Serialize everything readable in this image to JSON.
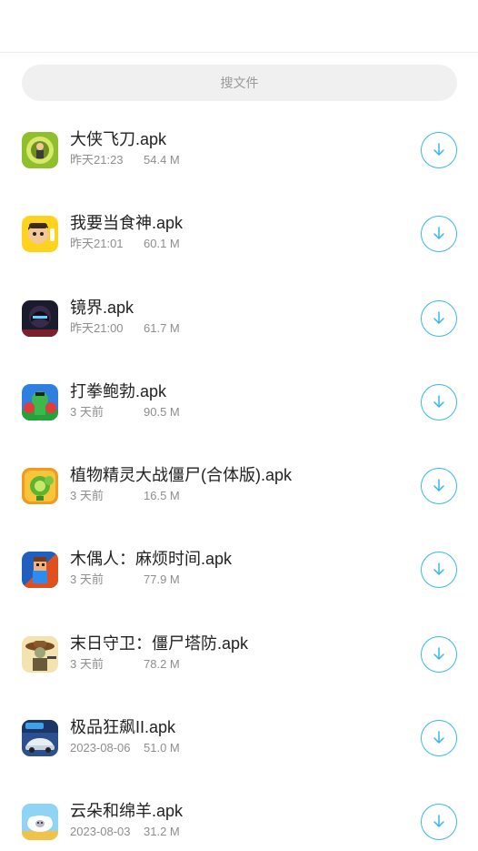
{
  "search": {
    "placeholder": "搜文件"
  },
  "files": [
    {
      "name": "大侠飞刀.apk",
      "date": "昨天21:23",
      "size": "54.4 M",
      "icon": "swordsman-game-icon"
    },
    {
      "name": "我要当食神.apk",
      "date": "昨天21:01",
      "size": "60.1 M",
      "icon": "chef-game-icon"
    },
    {
      "name": "镜界.apk",
      "date": "昨天21:00",
      "size": "61.7 M",
      "icon": "mirror-realm-game-icon"
    },
    {
      "name": "打拳鲍勃.apk",
      "date": "3 天前",
      "size": "90.5 M",
      "icon": "boxing-bob-game-icon"
    },
    {
      "name": "植物精灵大战僵尸(合体版).apk",
      "date": "3 天前",
      "size": "16.5 M",
      "icon": "plants-vs-zombies-game-icon"
    },
    {
      "name": "木偶人：麻烦时间.apk",
      "date": "3 天前",
      "size": "77.9 M",
      "icon": "puppet-game-icon"
    },
    {
      "name": "末日守卫：僵尸塔防.apk",
      "date": "3 天前",
      "size": "78.2 M",
      "icon": "cowboy-zombie-defense-game-icon"
    },
    {
      "name": "极品狂飙II.apk",
      "date": "2023-08-06",
      "size": "51.0 M",
      "icon": "racing-car-game-icon"
    },
    {
      "name": "云朵和绵羊.apk",
      "date": "2023-08-03",
      "size": "31.2 M",
      "icon": "cloud-sheep-game-icon"
    }
  ],
  "colors": {
    "accent": "#35b9e8",
    "search_bg": "#f0f0f0"
  }
}
